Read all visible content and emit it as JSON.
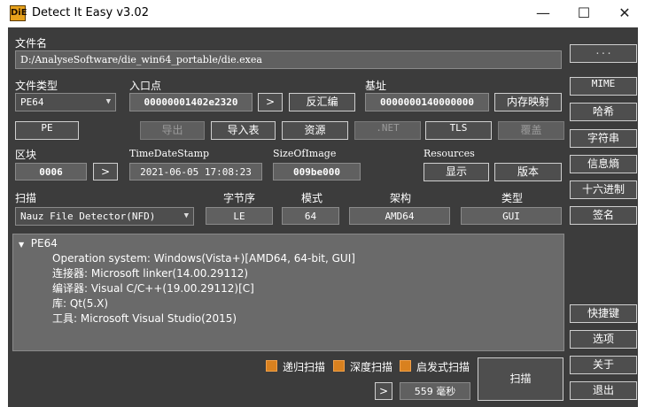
{
  "window": {
    "title": "Detect It Easy v3.02",
    "icon_text": "DiE"
  },
  "file": {
    "label": "文件名",
    "path": "D:/AnalyseSoftware/die_win64_portable/die.exea",
    "browse_label": "..."
  },
  "file_type": {
    "label": "文件类型",
    "value": "PE64"
  },
  "entry_point": {
    "label": "入口点",
    "value": "00000001402e2320",
    "go_label": ">",
    "disasm_label": "反汇编"
  },
  "base_address": {
    "label": "基址",
    "value": "0000000140000000",
    "memmap_label": "内存映射"
  },
  "row_buttons": {
    "pe": "PE",
    "export": "导出",
    "import": "导入表",
    "resources": "资源",
    "net": ".NET",
    "tls": "TLS",
    "overlay": "覆盖"
  },
  "sections": {
    "label": "区块",
    "value": "0006",
    "go_label": ">"
  },
  "timestamp": {
    "label": "TimeDateStamp",
    "value": "2021-06-05 17:08:23"
  },
  "size_of_image": {
    "label": "SizeOfImage",
    "value": "009be000"
  },
  "resources": {
    "label": "Resources",
    "show_label": "显示",
    "version_label": "版本"
  },
  "scan": {
    "label": "扫描",
    "engine": "Nauz File Detector(NFD)",
    "endianness_label": "字节序",
    "endianness": "LE",
    "mode_label": "模式",
    "mode": "64",
    "arch_label": "架构",
    "arch": "AMD64",
    "type_label": "类型",
    "type": "GUI"
  },
  "results": {
    "root": "PE64",
    "lines": [
      "Operation system: Windows(Vista+)[AMD64, 64-bit, GUI]",
      "连接器: Microsoft linker(14.00.29112)",
      "编译器: Visual C/C++(19.00.29112)[C]",
      "库: Qt(5.X)",
      "工具: Microsoft Visual Studio(2015)"
    ]
  },
  "options": {
    "recursive": "递归扫描",
    "deep": "深度扫描",
    "heuristic": "启发式扫描"
  },
  "bottom": {
    "go_label": ">",
    "elapsed": "559 毫秒",
    "scan_button": "扫描"
  },
  "sidebar": {
    "mime": "MIME",
    "hash": "哈希",
    "strings": "字符串",
    "entropy": "信息熵",
    "hex": "十六进制",
    "signatures": "签名",
    "shortcuts": "快捷键",
    "options": "选项",
    "about": "关于",
    "exit": "退出"
  },
  "colors": {
    "background": "#3c3c3c",
    "field": "#606060",
    "checkbox": "#d9811f",
    "results_panel": "#6a6a6a"
  }
}
